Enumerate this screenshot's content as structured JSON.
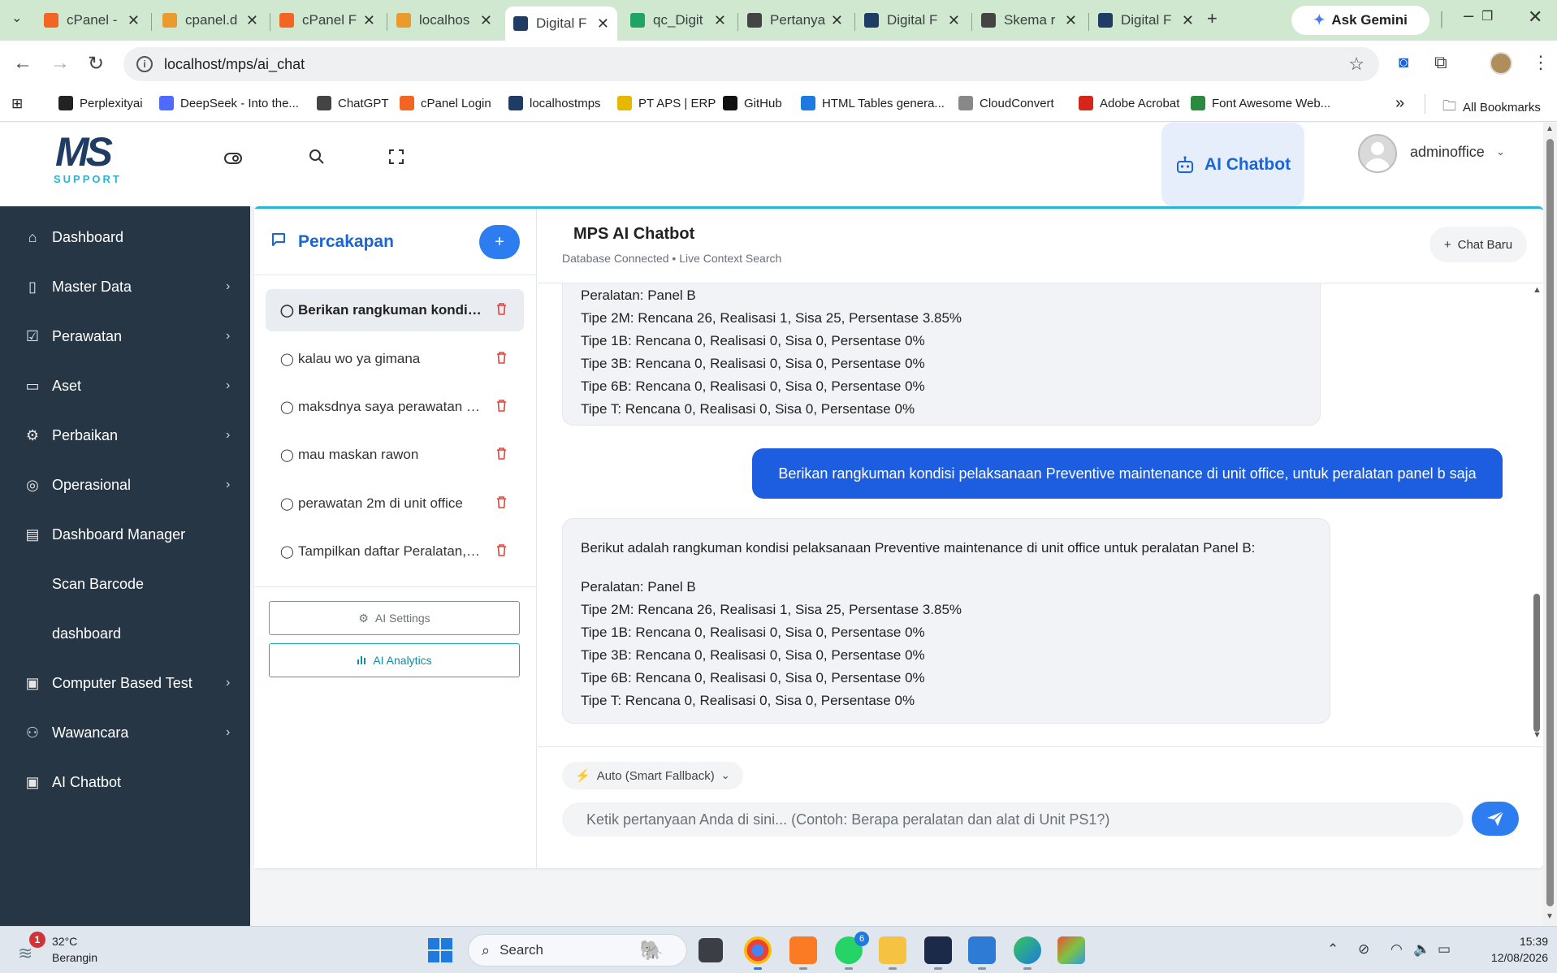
{
  "browser": {
    "tabs": [
      {
        "title": "cPanel -",
        "icon": "cpanel-icon",
        "color": "#f26522"
      },
      {
        "title": "cpanel.d",
        "icon": "phpmyadmin-icon",
        "color": "#e99b2e"
      },
      {
        "title": "cPanel F",
        "icon": "cpanel-icon",
        "color": "#f26522"
      },
      {
        "title": "localhos",
        "icon": "phpmyadmin-icon",
        "color": "#e99b2e"
      },
      {
        "title": "Digital F",
        "icon": "mps-icon",
        "color": "#1f3d64",
        "active": true
      },
      {
        "title": "qc_Digit",
        "icon": "sheets-icon",
        "color": "#1fa463"
      },
      {
        "title": "Pertanya",
        "icon": "chatgpt-icon",
        "color": "#444444"
      },
      {
        "title": "Digital F",
        "icon": "mps-icon",
        "color": "#1f3d64"
      },
      {
        "title": "Skema r",
        "icon": "chatgpt-icon",
        "color": "#444444"
      },
      {
        "title": "Digital F",
        "icon": "mps-icon",
        "color": "#1f3d64"
      }
    ],
    "gemini_label": "Ask Gemini",
    "url": "localhost/mps/ai_chat",
    "bookmarks": [
      {
        "label": "Perplexityai",
        "color": "#222222"
      },
      {
        "label": "DeepSeek - Into the...",
        "color": "#4d6bfe"
      },
      {
        "label": "ChatGPT",
        "color": "#444444"
      },
      {
        "label": "cPanel Login",
        "color": "#f26522"
      },
      {
        "label": "localhostmps",
        "color": "#1f3d64"
      },
      {
        "label": "PT APS | ERP",
        "color": "#e6b800"
      },
      {
        "label": "GitHub",
        "color": "#111111"
      },
      {
        "label": "HTML Tables genera...",
        "color": "#1f7ae0"
      },
      {
        "label": "CloudConvert",
        "color": "#888888"
      },
      {
        "label": "Adobe Acrobat",
        "color": "#d6261c"
      },
      {
        "label": "Font Awesome Web...",
        "color": "#2a8a3e"
      }
    ],
    "all_bookmarks_label": "All Bookmarks"
  },
  "app": {
    "logo_mark": "MS",
    "logo_sub": "SUPPORT",
    "ai_chatbot_button": "AI Chatbot",
    "username": "adminoffice"
  },
  "sidebar": {
    "items": [
      {
        "label": "Dashboard",
        "icon": "home-icon",
        "has_children": false
      },
      {
        "label": "Master Data",
        "icon": "book-icon",
        "has_children": true
      },
      {
        "label": "Perawatan",
        "icon": "checkbox-icon",
        "has_children": true
      },
      {
        "label": "Aset",
        "icon": "monitor-icon",
        "has_children": true
      },
      {
        "label": "Perbaikan",
        "icon": "gear-icon",
        "has_children": true
      },
      {
        "label": "Operasional",
        "icon": "aperture-icon",
        "has_children": true
      },
      {
        "label": "Dashboard Manager",
        "icon": "briefcase-icon",
        "has_children": false
      },
      {
        "label": "Scan Barcode",
        "icon": "",
        "has_children": false
      },
      {
        "label": "dashboard",
        "icon": "",
        "has_children": false
      },
      {
        "label": "Computer Based Test",
        "icon": "cpu-icon",
        "has_children": true
      },
      {
        "label": "Wawancara",
        "icon": "users-icon",
        "has_children": true
      },
      {
        "label": "AI Chatbot",
        "icon": "cpu-icon",
        "has_children": false
      }
    ]
  },
  "conversations": {
    "title": "Percakapan",
    "add_label": "+",
    "items": [
      {
        "text": "Berikan rangkuman kondisi pelaksanaan Preventive maintenance di unit office, untuk peralatan panel b saja",
        "active": true
      },
      {
        "text": "kalau wo ya gimana",
        "active": false
      },
      {
        "text": "maksdnya saya perawatan yang di unit office",
        "active": false
      },
      {
        "text": "mau maskan rawon",
        "active": false
      },
      {
        "text": "perawatan 2m di unit office",
        "active": false
      },
      {
        "text": "Tampilkan daftar Peralatan, dan alat di unit",
        "active": false
      }
    ],
    "settings_label": "AI Settings",
    "analytics_label": "AI Analytics"
  },
  "chat": {
    "title": "MPS AI Chatbot",
    "subtitle": "Database Connected • Live Context Search",
    "new_chat_label": "Chat Baru",
    "messages": [
      {
        "role": "bot",
        "lines": [
          "Peralatan: Panel B",
          "Tipe 2M: Rencana 26, Realisasi 1, Sisa 25, Persentase 3.85%",
          "Tipe 1B: Rencana 0, Realisasi 0, Sisa 0, Persentase 0%",
          "Tipe 3B: Rencana 0, Realisasi 0, Sisa 0, Persentase 0%",
          "Tipe 6B: Rencana 0, Realisasi 0, Sisa 0, Persentase 0%",
          "Tipe T: Rencana 0, Realisasi 0, Sisa 0, Persentase 0%"
        ]
      },
      {
        "role": "user",
        "text": "Berikan rangkuman kondisi pelaksanaan Preventive maintenance di unit office, untuk peralatan panel b saja"
      },
      {
        "role": "bot",
        "intro": "Berikut adalah rangkuman kondisi pelaksanaan Preventive maintenance di unit office untuk peralatan Panel B:",
        "lines": [
          "Peralatan: Panel B",
          "Tipe 2M: Rencana 26, Realisasi 1, Sisa 25, Persentase 3.85%",
          "Tipe 1B: Rencana 0, Realisasi 0, Sisa 0, Persentase 0%",
          "Tipe 3B: Rencana 0, Realisasi 0, Sisa 0, Persentase 0%",
          "Tipe 6B: Rencana 0, Realisasi 0, Sisa 0, Persentase 0%",
          "Tipe T: Rencana 0, Realisasi 0, Sisa 0, Persentase 0%"
        ]
      }
    ],
    "model_label": "Auto (Smart Fallback)",
    "input_placeholder": "Ketik pertanyaan Anda di sini... (Contoh: Berapa peralatan dan alat di Unit PS1?)"
  },
  "taskbar": {
    "weather_badge": "1",
    "temperature": "32°C",
    "condition": "Berangin",
    "search_label": "Search",
    "whatsapp_badge": "6",
    "time": "15:39",
    "date": "12/08/2026"
  },
  "colors": {
    "accent": "#1a66d6",
    "sidebar_bg": "#263645",
    "user_bubble": "#1d5ee0",
    "panel_top_border": "#27b6d9",
    "delete_red": "#e0453c"
  }
}
